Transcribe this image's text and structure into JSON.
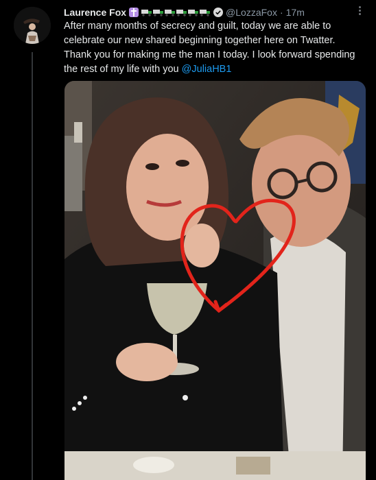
{
  "tweet": {
    "author_name": "Laurence Fox",
    "handle": "@LozzaFox",
    "separator": "·",
    "time": "17m",
    "text": "After many months of secrecy and guilt, today we are able to celebrate our new shared beginning together here on Twatter. Thank you for making me the man I today. I look forward spending the rest of my life with you",
    "mention": "@JuliaHB1",
    "icons": [
      "cross-emoji-icon",
      "truck-emoji-icon",
      "verified-badge-icon",
      "more-options-icon"
    ]
  },
  "media": {
    "description_icon": "photo-couple-with-drawn-heart"
  },
  "colors": {
    "background": "#000000",
    "text": "#e7e9ea",
    "muted": "#8b98a5",
    "link": "#1d9bf0",
    "heart": "#e2241b"
  }
}
